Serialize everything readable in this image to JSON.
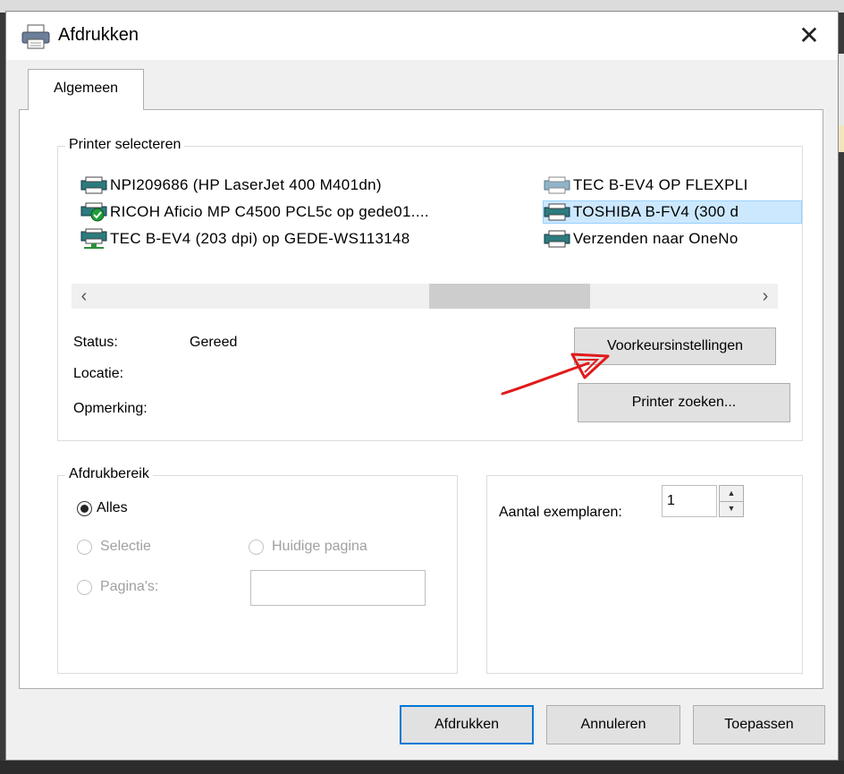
{
  "dialog": {
    "title": "Afdrukken",
    "close_label": "✕"
  },
  "tabs": [
    {
      "label": "Algemeen",
      "active": true
    }
  ],
  "printer_select": {
    "legend": "Printer selecteren",
    "printers": [
      {
        "label": "NPI209686 (HP LaserJet 400 M401dn)",
        "icon": "printer-icon"
      },
      {
        "label": "RICOH Aficio MP C4500 PCL5c op gede01....",
        "icon": "default-printer-icon"
      },
      {
        "label": "TEC B-EV4 (203 dpi) op GEDE-WS113148",
        "icon": "network-printer-icon"
      },
      {
        "label": "TEC B-EV4 OP FLEXPLI",
        "icon": "printer-icon"
      },
      {
        "label": "TOSHIBA B-FV4 (300 d",
        "icon": "printer-icon",
        "selected": true
      },
      {
        "label": "Verzenden naar OneNo",
        "icon": "printer-icon"
      }
    ],
    "scroll_left": "‹",
    "scroll_right": "›",
    "status_label": "Status:",
    "status_value": "Gereed",
    "location_label": "Locatie:",
    "comment_label": "Opmerking:",
    "preferences_button": "Voorkeursinstellingen",
    "find_printer_button": "Printer zoeken..."
  },
  "print_range": {
    "legend": "Afdrukbereik",
    "all": "Alles",
    "selection": "Selectie",
    "current_page": "Huidige pagina",
    "pages": "Pagina's:",
    "pages_value": ""
  },
  "copies": {
    "label": "Aantal exemplaren:",
    "value": "1"
  },
  "buttons": {
    "print": "Afdrukken",
    "cancel": "Annuleren",
    "apply": "Toepassen"
  },
  "annotation_color": "#e01b1b"
}
